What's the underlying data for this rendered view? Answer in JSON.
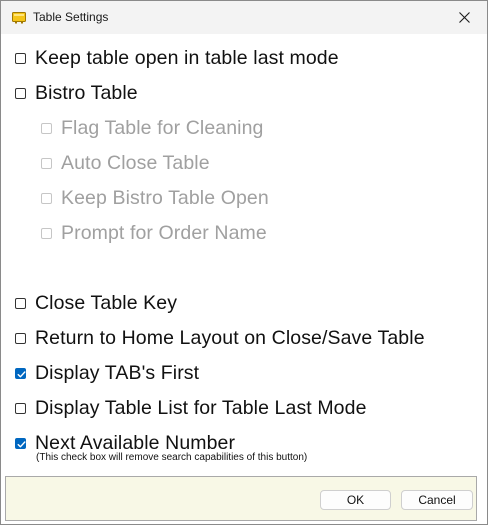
{
  "window": {
    "title": "Table Settings",
    "title_icon": "table-settings-icon",
    "close_icon": "close-icon"
  },
  "options": [
    {
      "label": "Keep table open in table last mode",
      "checked": false,
      "enabled": true
    },
    {
      "label": "Bistro Table",
      "checked": false,
      "enabled": true
    },
    {
      "label": "Flag Table for Cleaning",
      "checked": false,
      "enabled": false
    },
    {
      "label": "Auto Close Table",
      "checked": false,
      "enabled": false
    },
    {
      "label": "Keep Bistro Table Open",
      "checked": false,
      "enabled": false
    },
    {
      "label": "Prompt for Order Name",
      "checked": false,
      "enabled": false
    },
    {
      "label": "Close Table Key",
      "checked": false,
      "enabled": true
    },
    {
      "label": "Return to Home Layout on Close/Save Table",
      "checked": false,
      "enabled": true
    },
    {
      "label": "Display TAB's First",
      "checked": true,
      "enabled": true
    },
    {
      "label": "Display Table List for Table Last Mode",
      "checked": false,
      "enabled": true
    },
    {
      "label": "Next Available Number",
      "checked": true,
      "enabled": true
    }
  ],
  "next_available_note": "(This check box will remove search capabilities of this button)",
  "footer": {
    "ok_label": "OK",
    "cancel_label": "Cancel"
  },
  "colors": {
    "accent": "#0067c0",
    "disabled_text": "#a0a0a0",
    "footer_bg": "#f8f8e6"
  }
}
